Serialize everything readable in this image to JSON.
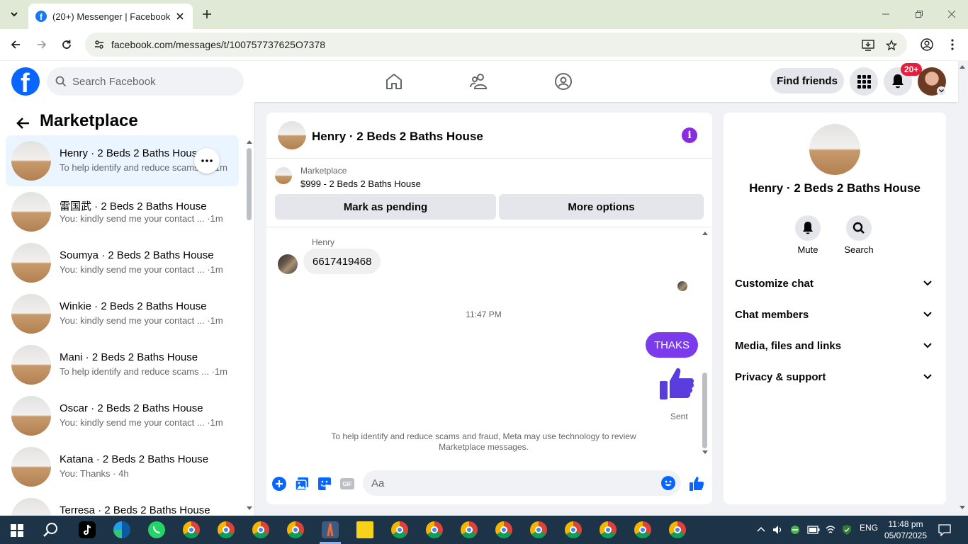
{
  "browser": {
    "tab_title": "(20+) Messenger | Facebook",
    "url": "facebook.com/messages/t/100757737625O7378"
  },
  "fb_header": {
    "search_placeholder": "Search Facebook",
    "find_friends": "Find friends",
    "notification_count": "20+"
  },
  "sidebar": {
    "title": "Marketplace",
    "conversations": [
      {
        "name": "Henry · 2 Beds 2 Baths House",
        "preview": "To help identify and reduce scams ... ·1m",
        "active": true
      },
      {
        "name": "雷国武 · 2 Beds 2 Baths House",
        "preview": "You: kindly send me your contact ... ·1m"
      },
      {
        "name": "Soumya · 2 Beds 2 Baths House",
        "preview": "You: kindly send me your contact ... ·1m"
      },
      {
        "name": "Winkie · 2 Beds 2 Baths House",
        "preview": "You: kindly send me your contact ... ·1m"
      },
      {
        "name": "Mani · 2 Beds 2 Baths House",
        "preview": "To help identify and reduce scams ... ·1m"
      },
      {
        "name": "Oscar · 2 Beds 2 Baths House",
        "preview": "You: kindly send me your contact ... ·1m"
      },
      {
        "name": "Katana · 2 Beds 2 Baths House",
        "preview": "You: Thanks · 4h"
      },
      {
        "name": "Terresa · 2 Beds 2 Baths House",
        "preview": ""
      }
    ]
  },
  "chat": {
    "title": "Henry · 2 Beds 2 Baths House",
    "marketplace_label": "Marketplace",
    "listing": "$999 - 2 Beds 2 Baths House",
    "mark_pending": "Mark as pending",
    "more_options": "More options",
    "sender_name": "Henry",
    "incoming_message": "6617419468",
    "timestamp": "11:47 PM",
    "outgoing_message": "THAKS",
    "sent_status": "Sent",
    "disclaimer": "To help identify and reduce scams and fraud, Meta may use technology to review Marketplace messages.",
    "composer_placeholder": "Aa",
    "gif_label": "GIF"
  },
  "info_panel": {
    "name": "Henry · 2 Beds 2 Baths House",
    "mute": "Mute",
    "search": "Search",
    "sections": [
      "Customize chat",
      "Chat members",
      "Media, files and links",
      "Privacy & support"
    ]
  },
  "taskbar": {
    "language": "ENG",
    "time": "11:48 pm",
    "date": "05/07/2025"
  },
  "colors": {
    "fb_blue": "#0866ff",
    "outgoing_bubble": "#7c3aed",
    "like_icon": "#5b3cdd",
    "notification_badge": "#e41e3f"
  }
}
